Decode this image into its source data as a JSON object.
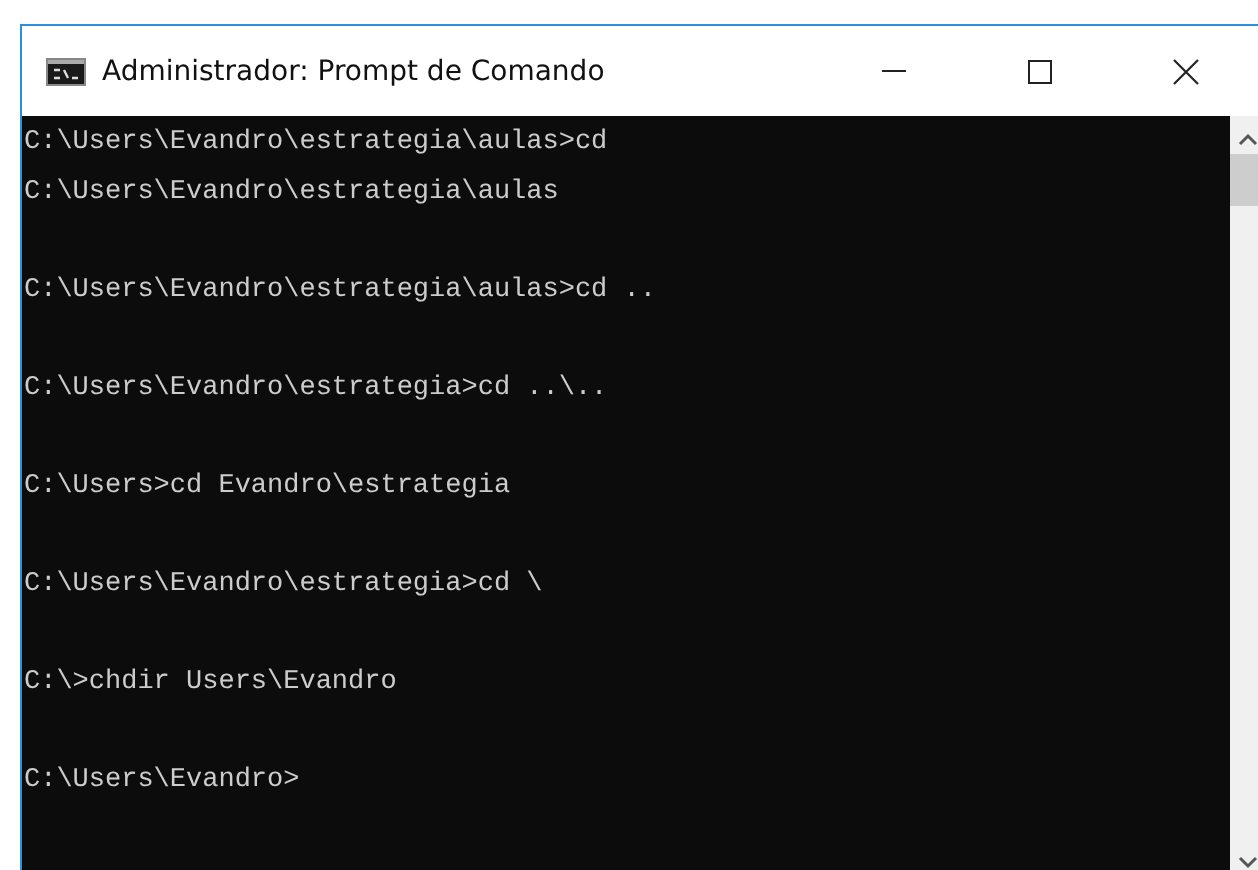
{
  "window": {
    "title": "Administrador: Prompt de Comando"
  },
  "console": {
    "blocks": [
      [
        "C:\\Users\\Evandro\\estrategia\\aulas>cd",
        "C:\\Users\\Evandro\\estrategia\\aulas"
      ],
      [
        "C:\\Users\\Evandro\\estrategia\\aulas>cd .."
      ],
      [
        "C:\\Users\\Evandro\\estrategia>cd ..\\.."
      ],
      [
        "C:\\Users>cd Evandro\\estrategia"
      ],
      [
        "C:\\Users\\Evandro\\estrategia>cd \\"
      ],
      [
        "C:\\>chdir Users\\Evandro"
      ],
      [
        "C:\\Users\\Evandro>"
      ]
    ]
  }
}
